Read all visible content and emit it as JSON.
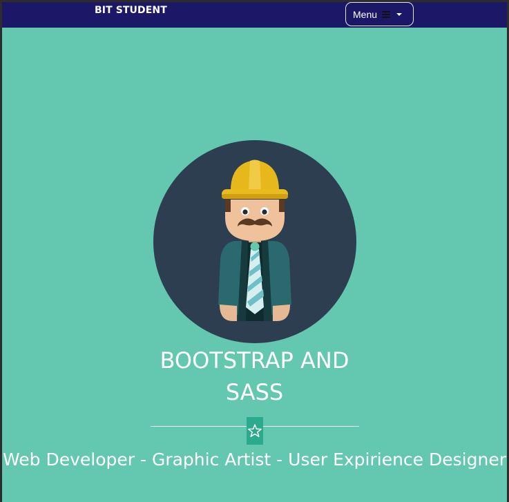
{
  "navbar": {
    "brand": "BIT STUDENT",
    "menu_label": "Menu"
  },
  "hero": {
    "title_line1": "BOOTSTRAP AND",
    "title_line2": "SASS",
    "subtitle": "Web Developer - Graphic Artist - User Expirience Designer"
  },
  "icons": {
    "menu": "bars-icon",
    "dropdown": "caret-down-icon",
    "divider": "star-icon",
    "avatar": "construction-worker-avatar"
  },
  "colors": {
    "navbar_bg": "#1b1868",
    "page_bg": "#64c7af",
    "avatar_circle": "#2d3e50",
    "star_box": "#2baa8d",
    "text": "#ffffff"
  }
}
